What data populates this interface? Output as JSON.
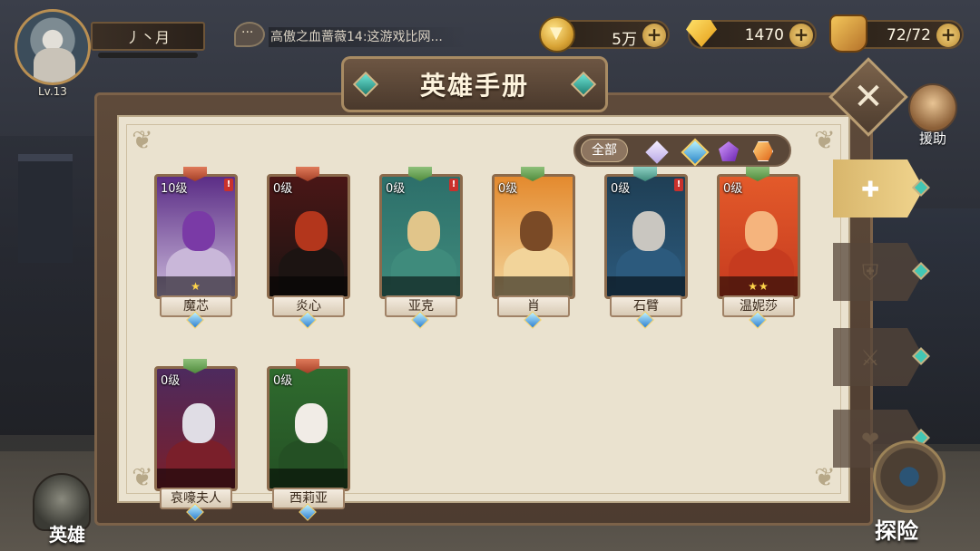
{
  "player": {
    "level": "Lv.13",
    "name": "丿丶月"
  },
  "chat": {
    "message": "高傲之血蔷薇14:这游戏比网..."
  },
  "resources": {
    "gold": "5万",
    "diamonds": "1470",
    "stamina": "72/72"
  },
  "panel": {
    "title": "英雄手册",
    "filter_all": "全部",
    "filters": [
      "light-gem-icon",
      "water-gem-icon",
      "dark-gem-icon",
      "fire-gem-icon"
    ]
  },
  "support": {
    "label": "援助"
  },
  "side_tabs": [
    "all-heroes-icon",
    "shield-icon",
    "sword-icon",
    "heart-icon"
  ],
  "heroes": [
    {
      "name": "魔芯",
      "level": "10级",
      "stars": "★",
      "badge": "red",
      "alert": true,
      "colors": [
        "#5b2d86",
        "#7a3aa6",
        "#c9b7d9"
      ]
    },
    {
      "name": "炎心",
      "level": "0级",
      "stars": "",
      "badge": "red",
      "alert": false,
      "colors": [
        "#4a1616",
        "#b3361c",
        "#1c1412"
      ]
    },
    {
      "name": "亚克",
      "level": "0级",
      "stars": "",
      "badge": "green",
      "alert": true,
      "colors": [
        "#2d6f6a",
        "#e1c58a",
        "#3f8b7c"
      ]
    },
    {
      "name": "肖",
      "level": "0级",
      "stars": "",
      "badge": "green",
      "alert": false,
      "colors": [
        "#e48a2e",
        "#7a4a26",
        "#f2d49a"
      ]
    },
    {
      "name": "石臂",
      "level": "0级",
      "stars": "",
      "badge": "teal",
      "alert": true,
      "colors": [
        "#1f3f55",
        "#c9c6c0",
        "#2c5a7d"
      ]
    },
    {
      "name": "温妮莎",
      "level": "0级",
      "stars": "★★",
      "badge": "green",
      "alert": false,
      "colors": [
        "#e35a2a",
        "#f5b47d",
        "#c63b1f"
      ]
    },
    {
      "name": "哀嚎夫人",
      "level": "0级",
      "stars": "",
      "badge": "green",
      "alert": false,
      "colors": [
        "#4d2a5e",
        "#e0dde5",
        "#7a1f2a"
      ]
    },
    {
      "name": "西莉亚",
      "level": "0级",
      "stars": "",
      "badge": "red",
      "alert": false,
      "colors": [
        "#2f6b2e",
        "#f1ece6",
        "#245024"
      ]
    }
  ],
  "bottom": {
    "heroes_label": "英雄",
    "explore_label": "探险"
  }
}
